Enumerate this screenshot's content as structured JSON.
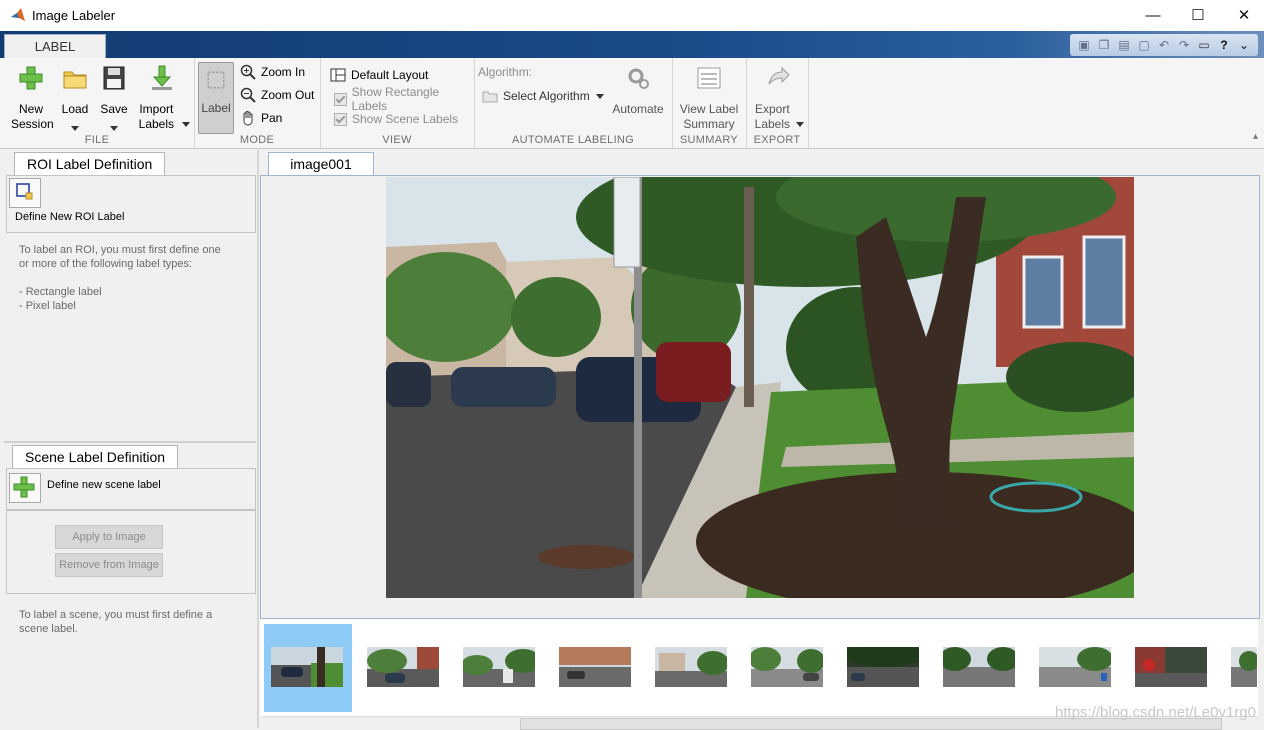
{
  "window": {
    "title": "Image Labeler",
    "minimize": "—",
    "maximize": "☐",
    "close": "✕"
  },
  "ribbon_tabs": [
    {
      "label": "LABEL"
    }
  ],
  "quick_access": [
    "save-icon",
    "copy-icon",
    "paste-icon",
    "cut-icon",
    "undo-icon",
    "redo-icon",
    "window-icon",
    "help-icon",
    "chevron-icon"
  ],
  "ribbon": {
    "file": {
      "label": "FILE",
      "new_session": "New Session",
      "load": "Load",
      "save": "Save",
      "import_labels": "Import Labels"
    },
    "mode": {
      "label": "MODE",
      "label_btn": "Label",
      "zoom_in": "Zoom In",
      "zoom_out": "Zoom Out",
      "pan": "Pan"
    },
    "view": {
      "label": "VIEW",
      "default_layout": "Default Layout",
      "show_rect_labels": "Show Rectangle Labels",
      "show_scene_labels": "Show Scene Labels"
    },
    "automate": {
      "label": "AUTOMATE LABELING",
      "algorithm_label": "Algorithm:",
      "select_algorithm": "Select Algorithm",
      "automate": "Automate"
    },
    "summary": {
      "label": "SUMMARY",
      "view_label_summary": "View Label Summary"
    },
    "export": {
      "label": "EXPORT",
      "export_labels": "Export Labels"
    }
  },
  "roi_panel": {
    "tab": "ROI Label Definition",
    "define_new": "Define New ROI Label",
    "hint1": "To label an ROI, you must first define one",
    "hint2": "or more of the following label types:",
    "type1": "- Rectangle label",
    "type2": "- Pixel label"
  },
  "scene_panel": {
    "tab": "Scene Label Definition",
    "define_new": "Define new scene label",
    "apply": "Apply to Image",
    "remove": "Remove from Image",
    "hint1": "To label a scene, you must first define a",
    "hint2": "scene label."
  },
  "image_tab": "image001",
  "thumbnails": [
    "thumb-1",
    "thumb-2",
    "thumb-3",
    "thumb-4",
    "thumb-5",
    "thumb-6",
    "thumb-7",
    "thumb-8",
    "thumb-9",
    "thumb-10",
    "thumb-11"
  ],
  "watermark": "https://blog.csdn.net/Le0v1rg0"
}
